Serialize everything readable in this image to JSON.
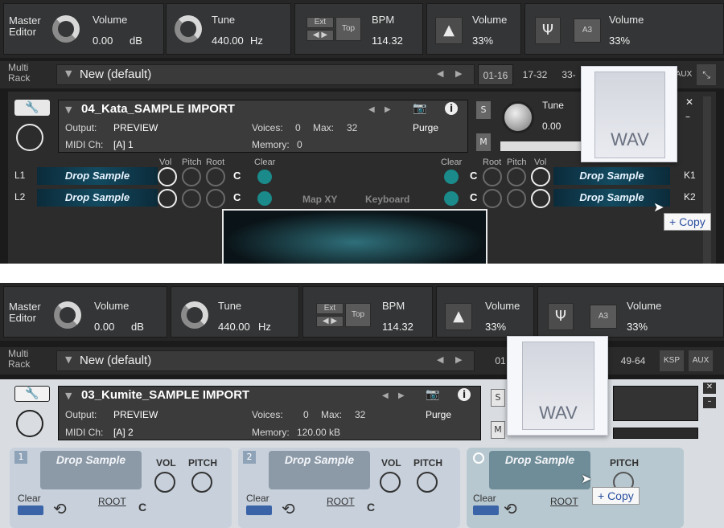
{
  "panel1": {
    "toolbar": {
      "master_label": "Master\nEditor",
      "volume_label": "Volume",
      "volume_value": "0.00",
      "volume_unit": "dB",
      "tune_label": "Tune",
      "tune_value": "440.00",
      "tune_unit": "Hz",
      "ext_label": "Ext",
      "tap_label": "Top",
      "bpm_label": "BPM",
      "bpm_value": "114.32",
      "vol2_label": "Volume",
      "vol2_value": "33%",
      "vol3_label": "Volume",
      "vol3_value": "33%",
      "a3_label": "A3"
    },
    "rack": {
      "label": "Multi\nRack",
      "title": "New (default)",
      "tabs": [
        "01-16",
        "17-32",
        "33-"
      ],
      "aux_label": "AUX"
    },
    "instrument": {
      "name": "04_Kata_SAMPLE IMPORT",
      "output_label": "Output:",
      "output_value": "PREVIEW",
      "voices_label": "Voices:",
      "voices_value": "0",
      "max_label": "Max:",
      "max_value": "32",
      "midi_label": "MIDI Ch:",
      "midi_value": "[A] 1",
      "memory_label": "Memory:",
      "memory_value": "0",
      "purge_label": "Purge",
      "tune_label": "Tune",
      "tune_value": "0.00",
      "s_label": "S",
      "m_label": "M"
    },
    "slots": {
      "col_vol": "Vol",
      "col_pitch": "Pitch",
      "col_root": "Root",
      "col_clear": "Clear",
      "drop_sample": "Drop Sample",
      "note": "C",
      "left_ids": [
        "L1",
        "L2"
      ],
      "right_ids": [
        "K1",
        "K2"
      ],
      "map_xy": "Map XY",
      "keyboard": "Keyboard"
    },
    "wav_label": "WAV",
    "copy_label": "+ Copy"
  },
  "panel2": {
    "toolbar": {
      "master_label": "Master\nEditor",
      "volume_label": "Volume",
      "volume_value": "0.00",
      "volume_unit": "dB",
      "tune_label": "Tune",
      "tune_value": "440.00",
      "tune_unit": "Hz",
      "ext_label": "Ext",
      "tap_label": "Top",
      "bpm_label": "BPM",
      "bpm_value": "114.32",
      "vol2_label": "Volume",
      "vol2_value": "33%",
      "vol3_label": "Volume",
      "vol3_value": "33%",
      "a3_label": "A3"
    },
    "rack": {
      "label": "Multi\nRack",
      "title": "New (default)",
      "tab_first": "01",
      "tab_last": "49-64",
      "ksp_label": "KSP",
      "aux_label": "AUX"
    },
    "instrument": {
      "name": "03_Kumite_SAMPLE IMPORT",
      "output_label": "Output:",
      "output_value": "PREVIEW",
      "voices_label": "Voices:",
      "voices_value": "0",
      "max_label": "Max:",
      "max_value": "32",
      "midi_label": "MIDI Ch:",
      "midi_value": "[A] 2",
      "memory_label": "Memory:",
      "memory_value": "120.00 kB",
      "purge_label": "Purge",
      "s_label": "S",
      "m_label": "M"
    },
    "zones": [
      {
        "num": "1",
        "drop": "Drop Sample",
        "vol": "VOL",
        "pitch": "PITCH",
        "clear": "Clear",
        "root": "ROOT",
        "note": "C"
      },
      {
        "num": "2",
        "drop": "Drop Sample",
        "vol": "VOL",
        "pitch": "PITCH",
        "clear": "Clear",
        "root": "ROOT",
        "note": "C"
      },
      {
        "num": "",
        "drop": "Drop Sample",
        "vol": "",
        "pitch": "PITCH",
        "clear": "Clear",
        "root": "ROOT",
        "note": ""
      }
    ],
    "wav_label": "WAV",
    "copy_label": "+ Copy"
  }
}
